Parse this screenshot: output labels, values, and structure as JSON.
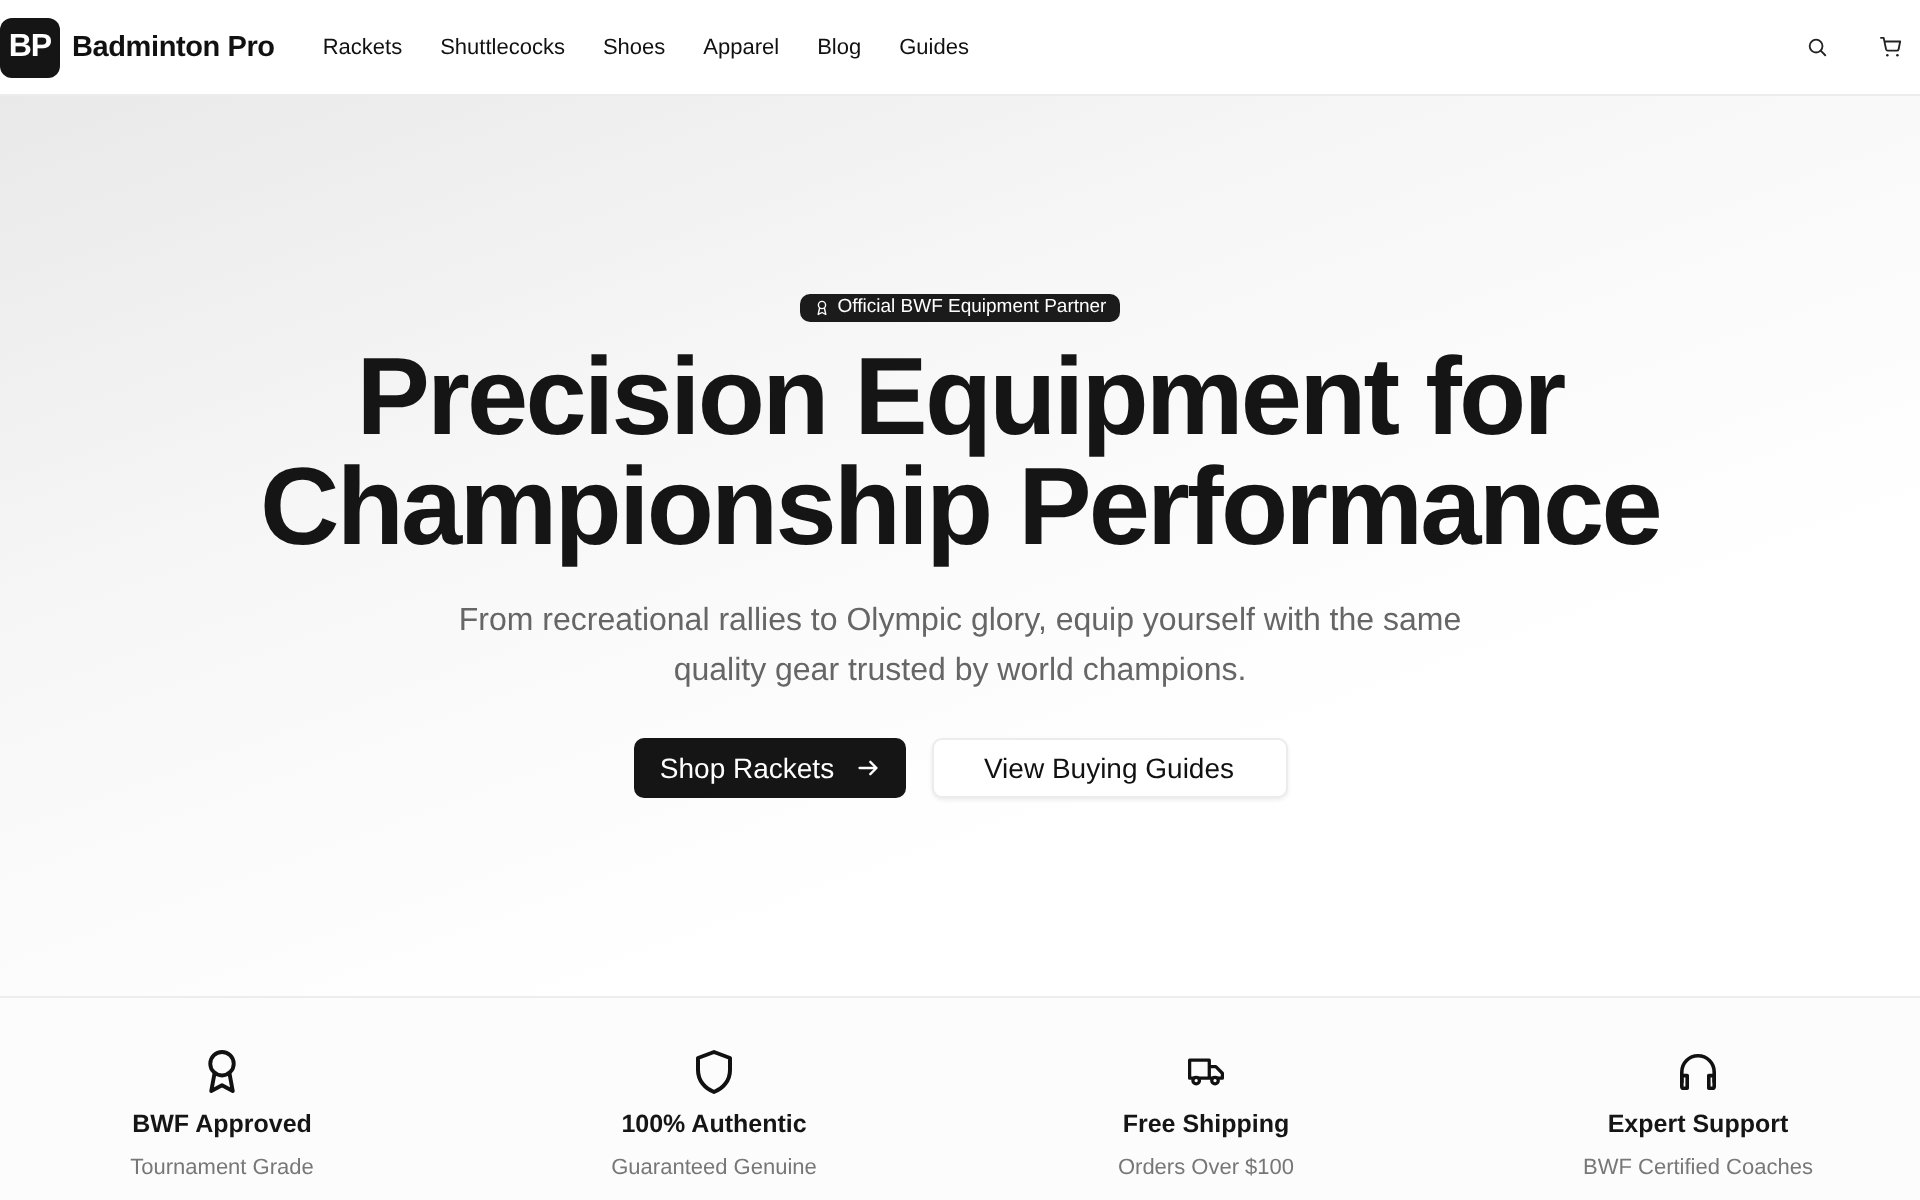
{
  "header": {
    "logo": {
      "mark": "BP",
      "name": "Badminton Pro"
    },
    "nav": [
      "Rackets",
      "Shuttlecocks",
      "Shoes",
      "Apparel",
      "Blog",
      "Guides"
    ]
  },
  "hero": {
    "badge": "Official BWF Equipment Partner",
    "title_lines": [
      "Precision Equipment for",
      "Championship Performance"
    ],
    "subtitle": "From recreational rallies to Olympic glory, equip yourself with the same quality gear trusted by world champions.",
    "buttons": [
      {
        "label": "Shop Rackets",
        "kind": "primary"
      },
      {
        "label": "View Buying Guides",
        "kind": "secondary"
      }
    ]
  },
  "features": [
    {
      "title": "BWF Approved",
      "subtitle": "Tournament Grade"
    },
    {
      "title": "100% Authentic",
      "subtitle": "Guaranteed Genuine"
    },
    {
      "title": "Free Shipping",
      "subtitle": "Orders Over $100"
    },
    {
      "title": "Expert Support",
      "subtitle": "BWF Certified Coaches"
    }
  ]
}
